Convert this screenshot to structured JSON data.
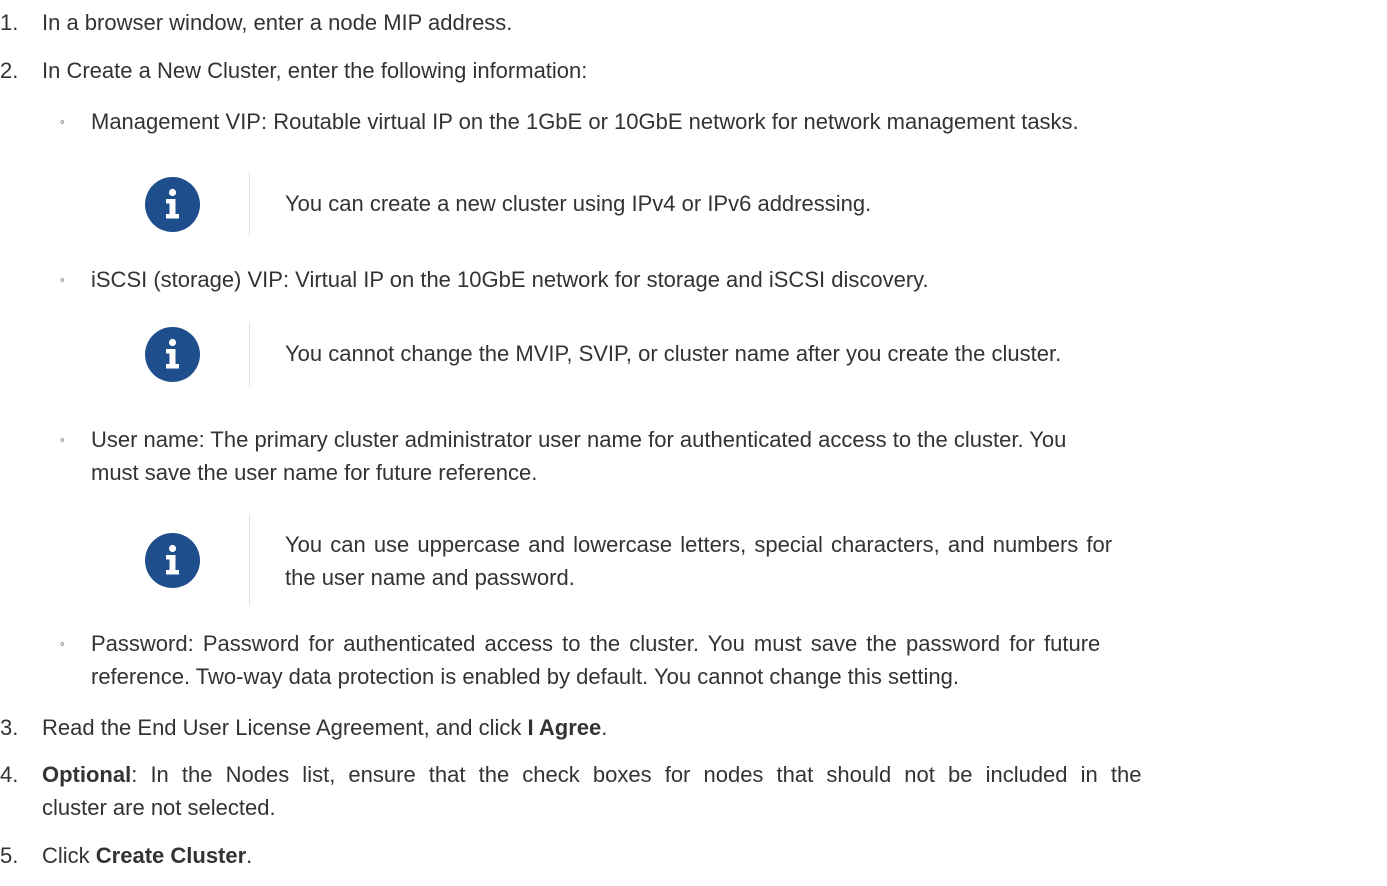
{
  "steps": [
    {
      "number": "1.",
      "text": "In a browser window, enter a node MIP address."
    },
    {
      "number": "2.",
      "text": "In Create a New Cluster, enter the following information:"
    },
    {
      "number": "3.",
      "text_before": "Read the End User License Agreement, and click ",
      "bold": "I Agree",
      "text_after": "."
    },
    {
      "number": "4.",
      "bold": "Optional",
      "line1": ": In the Nodes list, ensure that the check boxes for nodes that should not be included in the",
      "line2": "cluster are not selected."
    },
    {
      "number": "5.",
      "text_before": "Click ",
      "bold": "Create Cluster",
      "text_after": "."
    }
  ],
  "sub_items": [
    {
      "bullet": "◦",
      "text": "Management VIP: Routable virtual IP on the 1GbE or 10GbE network for network management tasks.",
      "note": "You can create a new cluster using IPv4 or IPv6 addressing."
    },
    {
      "bullet": "◦",
      "text": "iSCSI (storage) VIP: Virtual IP on the 10GbE network for storage and iSCSI discovery.",
      "note": "You cannot change the MVIP, SVIP, or cluster name after you create the cluster."
    },
    {
      "bullet": "◦",
      "line1": "User name: The primary cluster administrator user name for authenticated access to the cluster. You",
      "line2": "must save the user name for future reference.",
      "note_line1": "You can use uppercase and lowercase letters, special characters, and numbers for",
      "note_line2": "the user name and password."
    },
    {
      "bullet": "◦",
      "line1": "Password: Password for authenticated access to the cluster. You must save the password for future",
      "line2": "reference. Two-way data protection is enabled by default. You cannot change this setting."
    }
  ],
  "colors": {
    "text": "#333333",
    "info_icon_bg": "#1f4e8c",
    "divider": "#e3e3e3"
  },
  "icons": {
    "note": "info-icon"
  }
}
